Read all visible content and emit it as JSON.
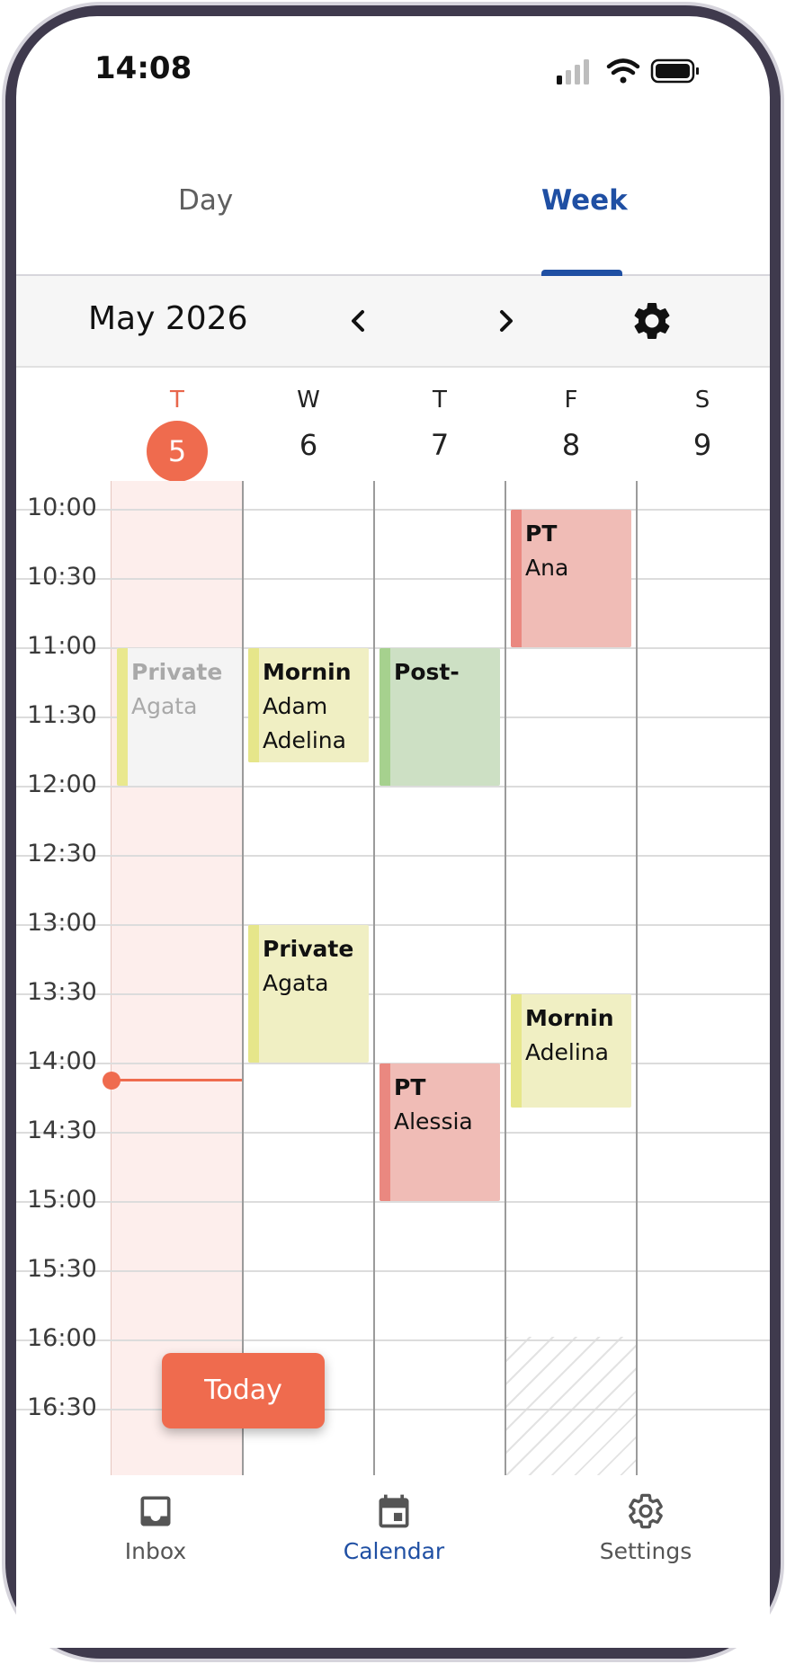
{
  "status_bar": {
    "time": "14:08",
    "icons": [
      "signal-icon",
      "wifi-icon",
      "battery-icon"
    ]
  },
  "tabs": [
    {
      "label": "Day",
      "active": false
    },
    {
      "label": "Week",
      "active": true
    }
  ],
  "toolbar": {
    "month_title": "May 2026",
    "prev_icon": "chevron-left-icon",
    "next_icon": "chevron-right-icon",
    "settings_icon": "gear-icon"
  },
  "days": [
    {
      "dow": "T",
      "num": "5",
      "today": true
    },
    {
      "dow": "W",
      "num": "6"
    },
    {
      "dow": "T",
      "num": "7"
    },
    {
      "dow": "F",
      "num": "8"
    },
    {
      "dow": "S",
      "num": "9"
    }
  ],
  "hours": [
    "10:00",
    "10:30",
    "11:00",
    "11:30",
    "12:00",
    "12:30",
    "13:00",
    "13:30",
    "14:00",
    "14:30",
    "15:00",
    "15:30",
    "16:00",
    "16:30"
  ],
  "events": [
    {
      "title": "Private",
      "subtitle": "Agata",
      "past": true
    },
    {
      "title": "Mornin",
      "subtitle": "Adam",
      "subtitle2": "Adelina"
    },
    {
      "title": "Post-"
    },
    {
      "title": "PT",
      "subtitle": "Ana"
    },
    {
      "title": "Private",
      "subtitle": "Agata"
    },
    {
      "title": "Mornin",
      "subtitle": "Adelina"
    },
    {
      "title": "PT",
      "subtitle": "Alessia"
    }
  ],
  "event_colors": {
    "yellow": "#f0efc3",
    "yellow_bar": "#e6e68a",
    "green": "#cde0c4",
    "green_bar": "#a6d18e",
    "red": "#f0bcb6",
    "red_bar": "#ea8880",
    "past": "#f4f4f4"
  },
  "accent": "#ef6b4e",
  "brand": "#1f4fa3",
  "today_button": "Today",
  "bottom_nav": [
    {
      "label": "Inbox",
      "icon": "inbox-icon",
      "active": false
    },
    {
      "label": "Calendar",
      "icon": "calendar-icon",
      "active": true
    },
    {
      "label": "Settings",
      "icon": "gear-icon",
      "active": false
    }
  ]
}
